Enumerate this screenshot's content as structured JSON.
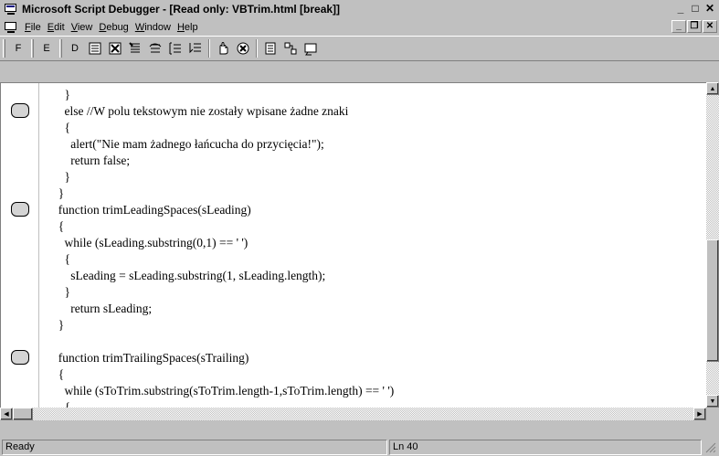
{
  "window": {
    "title": "Microsoft Script Debugger - [Read only: VBTrim.html [break]]",
    "controls": {
      "minimize": "_",
      "maximize": "□",
      "close": "✕"
    }
  },
  "menubar": {
    "items": [
      {
        "label": "File",
        "accel": "F",
        "rest": "ile"
      },
      {
        "label": "Edit",
        "accel": "E",
        "rest": "dit"
      },
      {
        "label": "View",
        "accel": "V",
        "rest": "iew"
      },
      {
        "label": "Debug",
        "accel": "D",
        "rest": "ebug"
      },
      {
        "label": "Window",
        "accel": "W",
        "rest": "indow"
      },
      {
        "label": "Help",
        "accel": "H",
        "rest": "elp"
      }
    ],
    "mdi_controls": {
      "minimize": "_",
      "restore": "❐",
      "close": "✕"
    }
  },
  "toolbar": {
    "buttons": [
      {
        "name": "tb-f",
        "label": "F"
      },
      {
        "name": "tb-e",
        "label": "E"
      },
      {
        "name": "tb-d",
        "label": "D"
      }
    ]
  },
  "editor": {
    "lines": [
      "    }",
      "    else //W polu tekstowym nie zostały wpisane żadne znaki",
      "    {",
      "      alert(\"Nie mam żadnego łańcucha do przycięcia!\");",
      "      return false;",
      "    }",
      "  }",
      "  function trimLeadingSpaces(sLeading)",
      "  {",
      "    while (sLeading.substring(0,1) == ' ')",
      "    {",
      "      sLeading = sLeading.substring(1, sLeading.length);",
      "    }",
      "      return sLeading;",
      "  }",
      "",
      "  function trimTrailingSpaces(sTrailing)",
      "  {",
      "    while (sToTrim.substring(sToTrim.length-1,sToTrim.length) == ' ')",
      "    {"
    ]
  },
  "statusbar": {
    "status": "Ready",
    "line": "Ln 40"
  }
}
